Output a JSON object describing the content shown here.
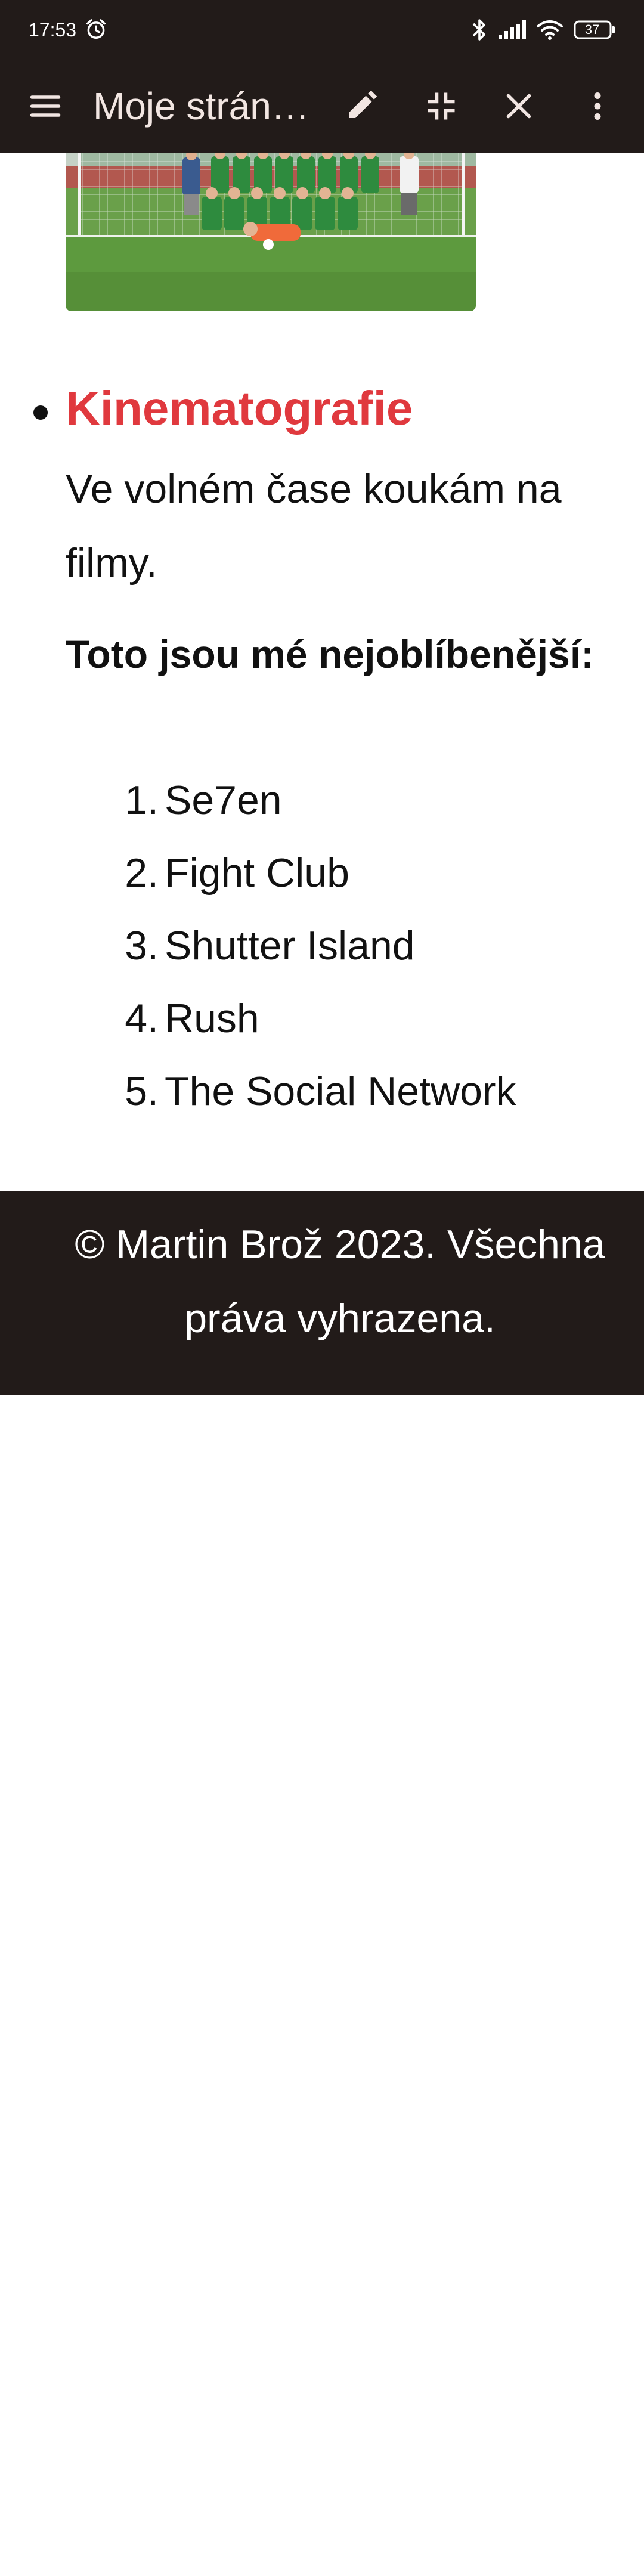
{
  "status_bar": {
    "time": "17:53",
    "battery": "37",
    "icons": [
      "alarm-icon",
      "bluetooth-icon",
      "signal-icon",
      "wifi-icon",
      "battery-icon"
    ]
  },
  "app_bar": {
    "title": "Moje strán…",
    "icons": [
      "menu-icon",
      "edit-icon",
      "collapse-icon",
      "close-icon",
      "more-vert-icon"
    ]
  },
  "content": {
    "section_title": "Kinematografie",
    "section_text": "Ve volném čase koukám na filmy.",
    "favorites_heading": "Toto jsou mé nejoblíbenější:",
    "movies": [
      {
        "num": "1.",
        "title": "Se7en"
      },
      {
        "num": "2.",
        "title": "Fight Club"
      },
      {
        "num": "3.",
        "title": "Shutter Island"
      },
      {
        "num": "4.",
        "title": "Rush"
      },
      {
        "num": "5.",
        "title": "The Social Network"
      }
    ]
  },
  "footer": {
    "text": "© Martin Brož 2023. Všechna práva vyhrazena."
  },
  "colors": {
    "bar_background": "#221b19",
    "heading_red": "#e0393e",
    "text": "#111111",
    "pitch_green": "#5d9a3e",
    "jersey_green": "#2e8b3e",
    "track_red": "#b24a46"
  }
}
